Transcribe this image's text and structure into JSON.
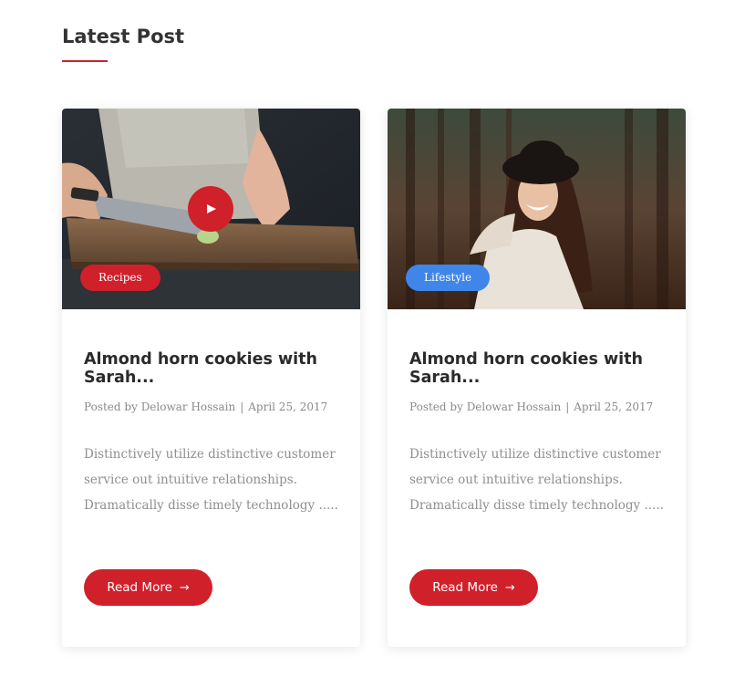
{
  "section": {
    "title": "Latest Post",
    "accent_color": "#d0202a"
  },
  "posts": [
    {
      "category": "Recipes",
      "category_color": "#d0202a",
      "has_video": true,
      "image": "chef-slicing-vegetable-on-cutting-board",
      "title": "Almond horn cookies with Sarah...",
      "posted_by_label": "Posted by",
      "author": "Delowar Hossain",
      "date": "April 25, 2017",
      "excerpt": "Distinctively utilize distinctive customer service out intuitive relationships. Dramatically disse timely technology .....",
      "button_label": "Read More",
      "button_icon": "arrow-right-icon"
    },
    {
      "category": "Lifestyle",
      "category_color": "#3f86e8",
      "has_video": false,
      "image": "smiling-woman-in-hat-in-forest",
      "title": "Almond horn cookies with Sarah...",
      "posted_by_label": "Posted by",
      "author": "Delowar Hossain",
      "date": "April 25, 2017",
      "excerpt": "Distinctively utilize distinctive customer service out intuitive relationships. Dramatically disse timely technology .....",
      "button_label": "Read More",
      "button_icon": "arrow-right-icon"
    }
  ]
}
